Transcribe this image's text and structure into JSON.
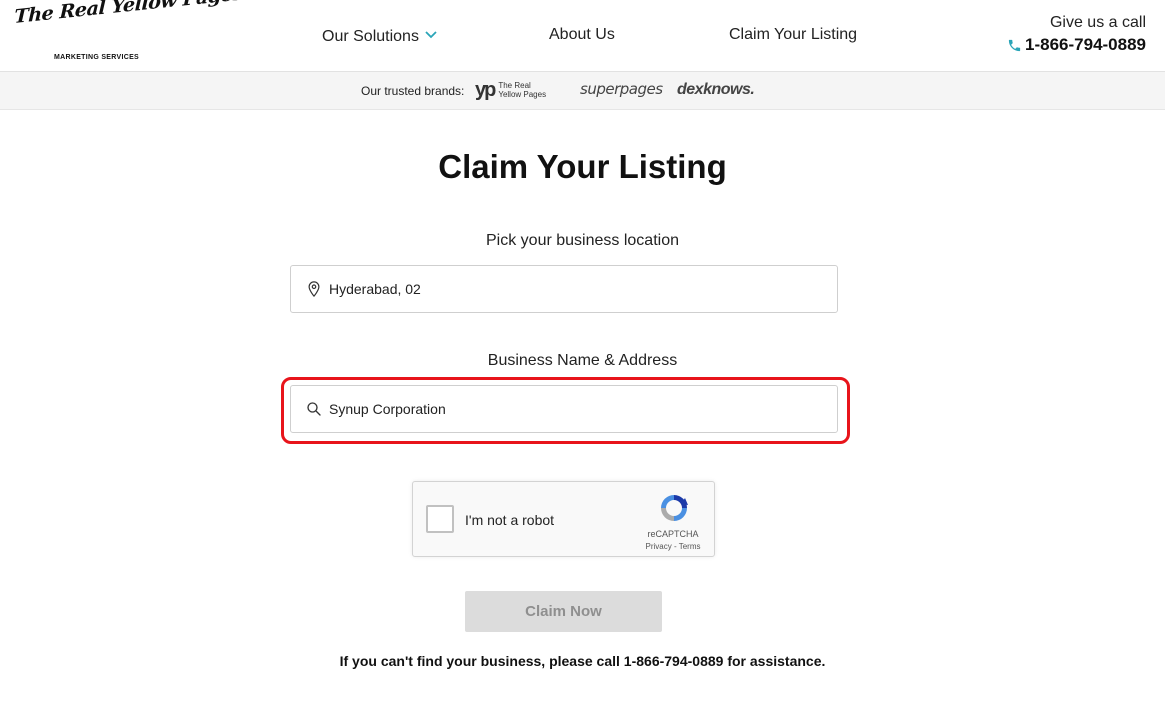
{
  "header": {
    "logo_text": "The Real Yellow Pages",
    "logo_subtitle": "MARKETING SERVICES",
    "nav": {
      "solutions": "Our Solutions",
      "about": "About Us",
      "claim": "Claim Your Listing"
    },
    "call_label": "Give us a call",
    "phone": "1-866-794-0889"
  },
  "brands": {
    "label": "Our trusted brands:",
    "yp_mark": "yp",
    "yp_line1": "The Real",
    "yp_line2": "Yellow Pages",
    "superpages": "superpages",
    "dexknows": "dexknows."
  },
  "main": {
    "title": "Claim Your Listing",
    "location_label": "Pick your business location",
    "location_value": "Hyderabad, 02",
    "business_label": "Business Name & Address",
    "business_value": "Synup Corporation",
    "captcha_label": "I'm not a robot",
    "captcha_brand": "reCAPTCHA",
    "captcha_links": "Privacy - Terms",
    "claim_button": "Claim Now",
    "help_text": "If you can't find your business, please call 1-866-794-0889 for assistance."
  },
  "icons": {
    "chevron": "chevron-down-icon",
    "phone": "phone-icon",
    "location": "map-pin-icon",
    "search": "search-icon",
    "recaptcha": "recaptcha-logo-icon"
  },
  "colors": {
    "accent_teal": "#2aa5b8",
    "highlight_red": "#e8141b",
    "button_disabled": "#dcdcdc"
  }
}
